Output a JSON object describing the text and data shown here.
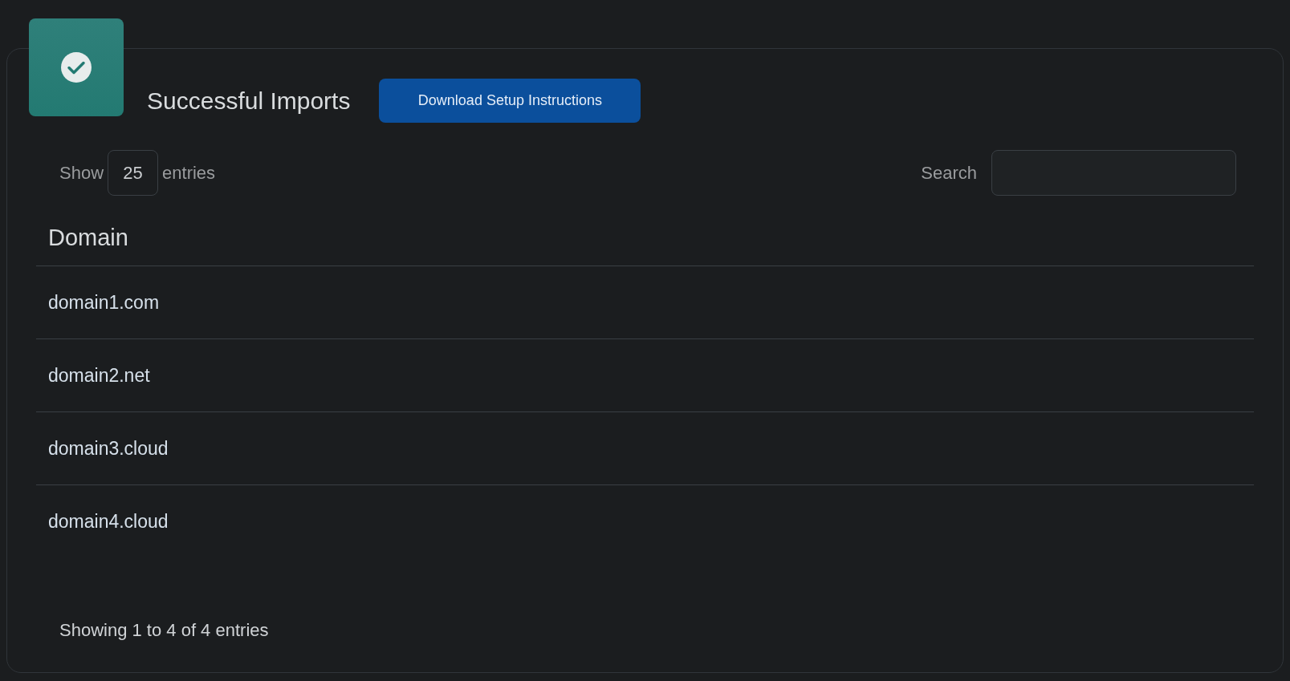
{
  "panel": {
    "title": "Successful Imports",
    "button": "Download Setup Instructions"
  },
  "length": {
    "label_before": "Show",
    "value": "25",
    "label_after": "entries"
  },
  "search": {
    "label": "Search"
  },
  "table": {
    "columns": [
      "Domain"
    ],
    "rows": [
      [
        "domain1.com"
      ],
      [
        "domain2.net"
      ],
      [
        "domain3.cloud"
      ],
      [
        "domain4.cloud"
      ]
    ]
  },
  "info": "Showing 1 to 4 of 4 entries"
}
